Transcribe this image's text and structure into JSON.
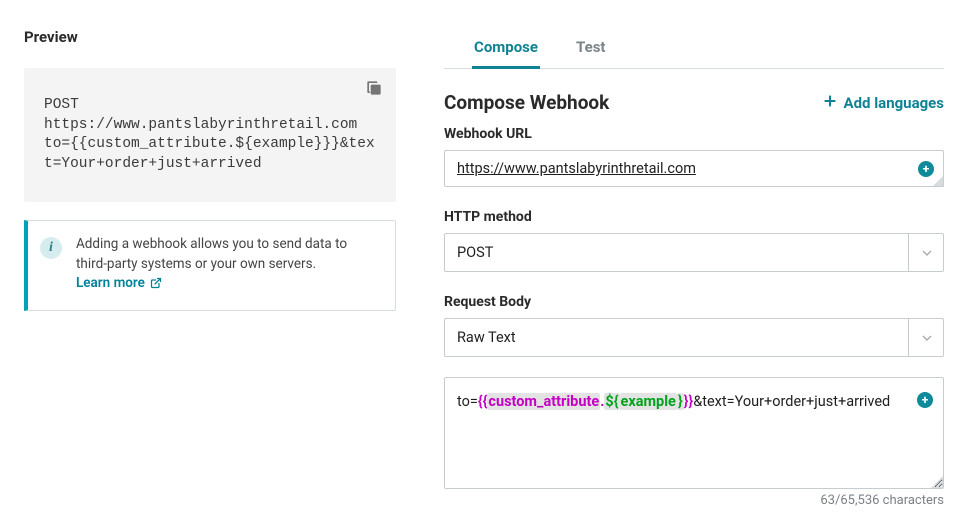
{
  "left": {
    "title": "Preview",
    "preview_text": "POST\nhttps://www.pantslabyrinthretail.com\nto={{custom_attribute.${example}}}&text=Your+order+just+arrived",
    "info_text": "Adding a webhook allows you to send data to third-party systems or your own servers.",
    "learn_more": "Learn more"
  },
  "right": {
    "tabs": {
      "compose": "Compose",
      "test": "Test"
    },
    "section_title": "Compose Webhook",
    "add_languages": "Add languages",
    "fields": {
      "url_label": "Webhook URL",
      "url_value": "https://www.pantslabyrinthretail.com",
      "method_label": "HTTP method",
      "method_value": "POST",
      "body_label": "Request Body",
      "body_type_value": "Raw Text",
      "body_content": {
        "prefix": "to=",
        "brace_open": "{{",
        "attribute": "custom_attribute",
        "dot": ".",
        "example_open": "${",
        "example": "example",
        "example_close": "}",
        "brace_close": "}}",
        "suffix": "&text=Your+order+just+arrived"
      },
      "char_count": "63/65,536 characters"
    }
  }
}
